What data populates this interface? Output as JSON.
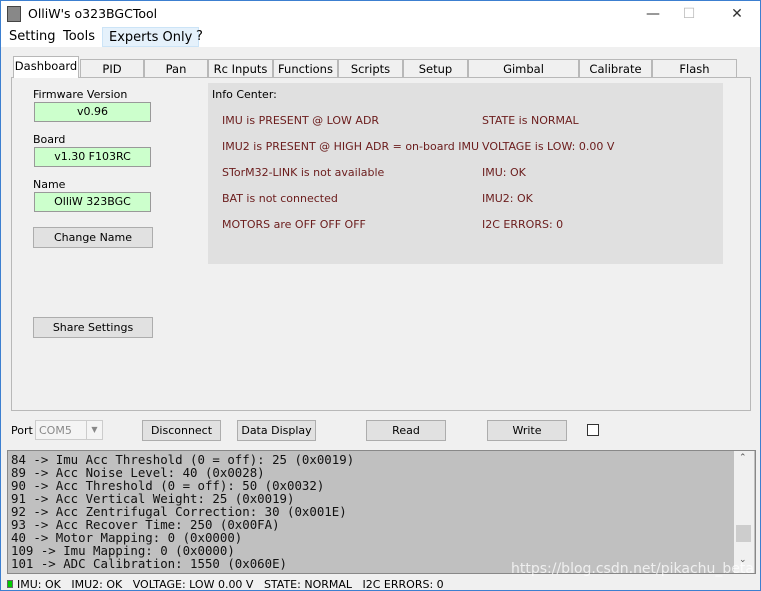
{
  "window": {
    "title": "OlliW's o323BGCTool"
  },
  "menu": [
    "Setting",
    "Tools",
    "Experts Only",
    "?"
  ],
  "tabs": [
    "Dashboard",
    "PID",
    "Pan",
    "Rc Inputs",
    "Functions",
    "Scripts",
    "Setup",
    "Gimbal Configuration",
    "Calibrate Acc",
    "Flash Firmware"
  ],
  "dashboard": {
    "firmware_label": "Firmware Version",
    "firmware_value": "v0.96",
    "board_label": "Board",
    "board_value": "v1.30 F103RC",
    "name_label": "Name",
    "name_value": "OlliW 323BGC",
    "change_name": "Change Name",
    "share_settings": "Share Settings",
    "info_title": "Info Center:",
    "info_left": [
      "IMU is PRESENT @ LOW ADR",
      "IMU2 is PRESENT @ HIGH ADR = on-board IMU",
      "STorM32-LINK is not available",
      "BAT is not connected",
      "MOTORS are OFF OFF OFF"
    ],
    "info_right": [
      "STATE is NORMAL",
      "VOLTAGE is LOW: 0.00 V",
      "IMU: OK",
      "IMU2: OK",
      "I2C ERRORS: 0"
    ]
  },
  "toolbar": {
    "port_label": "Port",
    "port_value": "COM5",
    "disconnect": "Disconnect",
    "data_display": "Data Display",
    "read": "Read",
    "write": "Write"
  },
  "log": [
    "84 -> Imu Acc Threshold (0 = off): 25 (0x0019)",
    "89 -> Acc Noise Level: 40 (0x0028)",
    "90 -> Acc Threshold (0 = off): 50 (0x0032)",
    "91 -> Acc Vertical Weight: 25 (0x0019)",
    "92 -> Acc Zentrifugal Correction: 30 (0x001E)",
    "93 -> Acc Recover Time: 250 (0x00FA)",
    "40 -> Motor Mapping: 0 (0x0000)",
    "109 -> Imu Mapping: 0 (0x0000)",
    "101 -> ADC Calibration: 1550 (0x060E)"
  ],
  "status": {
    "text": "IMU: OK   IMU2: OK   VOLTAGE: LOW 0.00 V   STATE: NORMAL   I2C ERRORS: 0",
    "led_color": "#00cc00"
  },
  "watermark": "https://blog.csdn.net/pikachu_beta"
}
